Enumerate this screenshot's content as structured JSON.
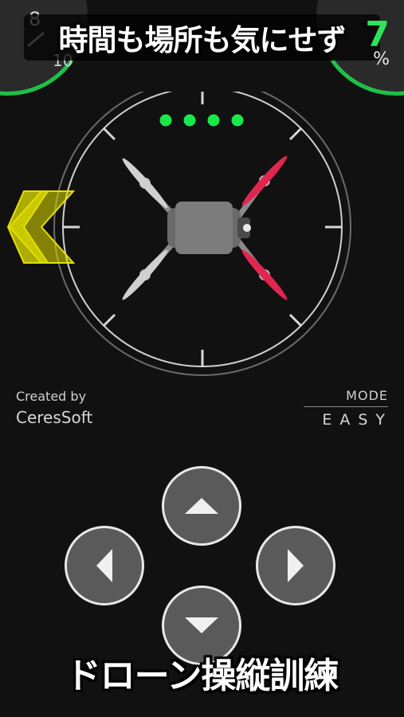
{
  "banner": {
    "title": "時間も場所も気にせず"
  },
  "gauge_left": {
    "value_top": "8",
    "value_bottom": "10"
  },
  "gauge_right": {
    "value": "7",
    "unit": "%"
  },
  "signal": {
    "bars": 4,
    "color": "#19e84a"
  },
  "credits": {
    "label": "Created by",
    "brand": "CeresSoft"
  },
  "mode": {
    "label": "MODE",
    "value": "EASY"
  },
  "footer": {
    "title": "ドローン操縦訓練"
  },
  "controls": {
    "up": "up-arrow-icon",
    "down": "down-arrow-icon",
    "left": "left-arrow-icon",
    "right": "right-arrow-icon"
  },
  "colors": {
    "background": "#111111",
    "gauge_green": "#1ec04a",
    "arrow_yellow": "#e2e000",
    "propeller_red": "#e0264f",
    "button_fill": "#5a5a5a"
  }
}
